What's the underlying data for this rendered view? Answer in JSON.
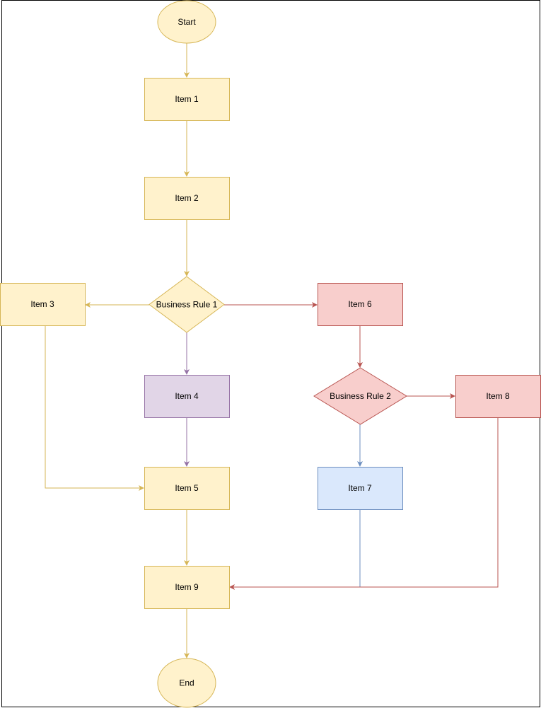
{
  "diagram": {
    "type": "flowchart",
    "colors": {
      "yellow_fill": "#fff2cc",
      "yellow_stroke": "#d6b656",
      "red_fill": "#f8cecc",
      "red_stroke": "#b85450",
      "purple_fill": "#e1d5e7",
      "purple_stroke": "#9673a6",
      "blue_fill": "#dae8fc",
      "blue_stroke": "#6c8ebf"
    },
    "nodes": [
      {
        "id": "start",
        "label": "Start",
        "shape": "ellipse",
        "color": "yellow"
      },
      {
        "id": "item1",
        "label": "Item 1",
        "shape": "rect",
        "color": "yellow"
      },
      {
        "id": "item2",
        "label": "Item 2",
        "shape": "rect",
        "color": "yellow"
      },
      {
        "id": "br1",
        "label": "Business Rule 1",
        "shape": "diamond",
        "color": "yellow"
      },
      {
        "id": "item3",
        "label": "Item 3",
        "shape": "rect",
        "color": "yellow"
      },
      {
        "id": "item4",
        "label": "Item 4",
        "shape": "rect",
        "color": "purple"
      },
      {
        "id": "item5",
        "label": "Item 5",
        "shape": "rect",
        "color": "yellow"
      },
      {
        "id": "item6",
        "label": "Item 6",
        "shape": "rect",
        "color": "red"
      },
      {
        "id": "br2",
        "label": "Business Rule 2",
        "shape": "diamond",
        "color": "red"
      },
      {
        "id": "item7",
        "label": "Item 7",
        "shape": "rect",
        "color": "blue"
      },
      {
        "id": "item8",
        "label": "Item 8",
        "shape": "rect",
        "color": "red"
      },
      {
        "id": "item9",
        "label": "Item 9",
        "shape": "rect",
        "color": "yellow"
      },
      {
        "id": "end",
        "label": "End",
        "shape": "ellipse",
        "color": "yellow"
      }
    ],
    "edges": [
      {
        "from": "start",
        "to": "item1",
        "color": "yellow"
      },
      {
        "from": "item1",
        "to": "item2",
        "color": "yellow"
      },
      {
        "from": "item2",
        "to": "br1",
        "color": "yellow"
      },
      {
        "from": "br1",
        "to": "item3",
        "color": "yellow"
      },
      {
        "from": "br1",
        "to": "item6",
        "color": "red"
      },
      {
        "from": "br1",
        "to": "item4",
        "color": "purple"
      },
      {
        "from": "item3",
        "to": "item5",
        "color": "yellow"
      },
      {
        "from": "item4",
        "to": "item5",
        "color": "purple"
      },
      {
        "from": "item6",
        "to": "br2",
        "color": "red"
      },
      {
        "from": "br2",
        "to": "item8",
        "color": "red"
      },
      {
        "from": "br2",
        "to": "item7",
        "color": "blue"
      },
      {
        "from": "item7",
        "to": "item9",
        "color": "blue"
      },
      {
        "from": "item8",
        "to": "item9",
        "color": "red"
      },
      {
        "from": "item5",
        "to": "item9",
        "color": "yellow"
      },
      {
        "from": "item9",
        "to": "end",
        "color": "yellow"
      }
    ]
  }
}
